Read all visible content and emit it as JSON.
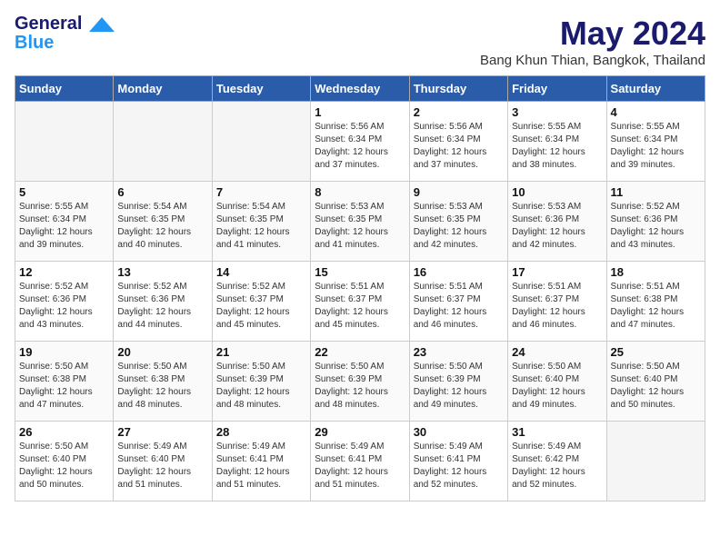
{
  "header": {
    "logo_line1": "General",
    "logo_line2": "Blue",
    "month_title": "May 2024",
    "location": "Bang Khun Thian, Bangkok, Thailand"
  },
  "days_of_week": [
    "Sunday",
    "Monday",
    "Tuesday",
    "Wednesday",
    "Thursday",
    "Friday",
    "Saturday"
  ],
  "weeks": [
    [
      {
        "day": "",
        "empty": true
      },
      {
        "day": "",
        "empty": true
      },
      {
        "day": "",
        "empty": true
      },
      {
        "day": "1",
        "sunrise": "5:56 AM",
        "sunset": "6:34 PM",
        "daylight": "12 hours and 37 minutes."
      },
      {
        "day": "2",
        "sunrise": "5:56 AM",
        "sunset": "6:34 PM",
        "daylight": "12 hours and 37 minutes."
      },
      {
        "day": "3",
        "sunrise": "5:55 AM",
        "sunset": "6:34 PM",
        "daylight": "12 hours and 38 minutes."
      },
      {
        "day": "4",
        "sunrise": "5:55 AM",
        "sunset": "6:34 PM",
        "daylight": "12 hours and 39 minutes."
      }
    ],
    [
      {
        "day": "5",
        "sunrise": "5:55 AM",
        "sunset": "6:34 PM",
        "daylight": "12 hours and 39 minutes."
      },
      {
        "day": "6",
        "sunrise": "5:54 AM",
        "sunset": "6:35 PM",
        "daylight": "12 hours and 40 minutes."
      },
      {
        "day": "7",
        "sunrise": "5:54 AM",
        "sunset": "6:35 PM",
        "daylight": "12 hours and 41 minutes."
      },
      {
        "day": "8",
        "sunrise": "5:53 AM",
        "sunset": "6:35 PM",
        "daylight": "12 hours and 41 minutes."
      },
      {
        "day": "9",
        "sunrise": "5:53 AM",
        "sunset": "6:35 PM",
        "daylight": "12 hours and 42 minutes."
      },
      {
        "day": "10",
        "sunrise": "5:53 AM",
        "sunset": "6:36 PM",
        "daylight": "12 hours and 42 minutes."
      },
      {
        "day": "11",
        "sunrise": "5:52 AM",
        "sunset": "6:36 PM",
        "daylight": "12 hours and 43 minutes."
      }
    ],
    [
      {
        "day": "12",
        "sunrise": "5:52 AM",
        "sunset": "6:36 PM",
        "daylight": "12 hours and 43 minutes."
      },
      {
        "day": "13",
        "sunrise": "5:52 AM",
        "sunset": "6:36 PM",
        "daylight": "12 hours and 44 minutes."
      },
      {
        "day": "14",
        "sunrise": "5:52 AM",
        "sunset": "6:37 PM",
        "daylight": "12 hours and 45 minutes."
      },
      {
        "day": "15",
        "sunrise": "5:51 AM",
        "sunset": "6:37 PM",
        "daylight": "12 hours and 45 minutes."
      },
      {
        "day": "16",
        "sunrise": "5:51 AM",
        "sunset": "6:37 PM",
        "daylight": "12 hours and 46 minutes."
      },
      {
        "day": "17",
        "sunrise": "5:51 AM",
        "sunset": "6:37 PM",
        "daylight": "12 hours and 46 minutes."
      },
      {
        "day": "18",
        "sunrise": "5:51 AM",
        "sunset": "6:38 PM",
        "daylight": "12 hours and 47 minutes."
      }
    ],
    [
      {
        "day": "19",
        "sunrise": "5:50 AM",
        "sunset": "6:38 PM",
        "daylight": "12 hours and 47 minutes."
      },
      {
        "day": "20",
        "sunrise": "5:50 AM",
        "sunset": "6:38 PM",
        "daylight": "12 hours and 48 minutes."
      },
      {
        "day": "21",
        "sunrise": "5:50 AM",
        "sunset": "6:39 PM",
        "daylight": "12 hours and 48 minutes."
      },
      {
        "day": "22",
        "sunrise": "5:50 AM",
        "sunset": "6:39 PM",
        "daylight": "12 hours and 48 minutes."
      },
      {
        "day": "23",
        "sunrise": "5:50 AM",
        "sunset": "6:39 PM",
        "daylight": "12 hours and 49 minutes."
      },
      {
        "day": "24",
        "sunrise": "5:50 AM",
        "sunset": "6:40 PM",
        "daylight": "12 hours and 49 minutes."
      },
      {
        "day": "25",
        "sunrise": "5:50 AM",
        "sunset": "6:40 PM",
        "daylight": "12 hours and 50 minutes."
      }
    ],
    [
      {
        "day": "26",
        "sunrise": "5:50 AM",
        "sunset": "6:40 PM",
        "daylight": "12 hours and 50 minutes."
      },
      {
        "day": "27",
        "sunrise": "5:49 AM",
        "sunset": "6:40 PM",
        "daylight": "12 hours and 51 minutes."
      },
      {
        "day": "28",
        "sunrise": "5:49 AM",
        "sunset": "6:41 PM",
        "daylight": "12 hours and 51 minutes."
      },
      {
        "day": "29",
        "sunrise": "5:49 AM",
        "sunset": "6:41 PM",
        "daylight": "12 hours and 51 minutes."
      },
      {
        "day": "30",
        "sunrise": "5:49 AM",
        "sunset": "6:41 PM",
        "daylight": "12 hours and 52 minutes."
      },
      {
        "day": "31",
        "sunrise": "5:49 AM",
        "sunset": "6:42 PM",
        "daylight": "12 hours and 52 minutes."
      },
      {
        "day": "",
        "empty": true
      }
    ]
  ]
}
